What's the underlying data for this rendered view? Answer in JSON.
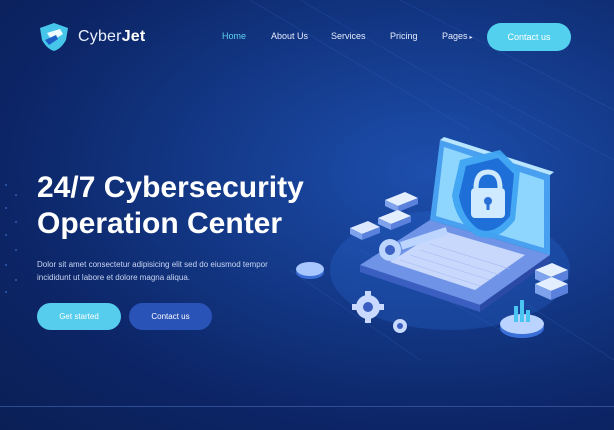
{
  "brand": {
    "name_part1": "Cyber",
    "name_part2": "Jet"
  },
  "nav": {
    "items": [
      {
        "label": "Home",
        "active": true
      },
      {
        "label": "About Us",
        "active": false
      },
      {
        "label": "Services",
        "active": false
      },
      {
        "label": "Pricing",
        "active": false
      },
      {
        "label": "Pages",
        "active": false,
        "caret": "▸"
      }
    ],
    "contact_label": "Contact us"
  },
  "hero": {
    "title_line1": "24/7 Cybersecurity",
    "title_line2": "Operation Center",
    "description": "Dolor sit amet consectetur adipisicing elit sed do eiusmod tempor incididunt ut labore et dolore magna aliqua.",
    "primary_button": "Get started",
    "secondary_button": "Contact us"
  },
  "colors": {
    "accent": "#53d0ee",
    "background": "#0f2d73",
    "secondary_button": "#2a53b8"
  },
  "icons": [
    "shield-logo-icon",
    "laptop-security-illustration",
    "padlock-icon",
    "key-icon",
    "gear-icon"
  ]
}
